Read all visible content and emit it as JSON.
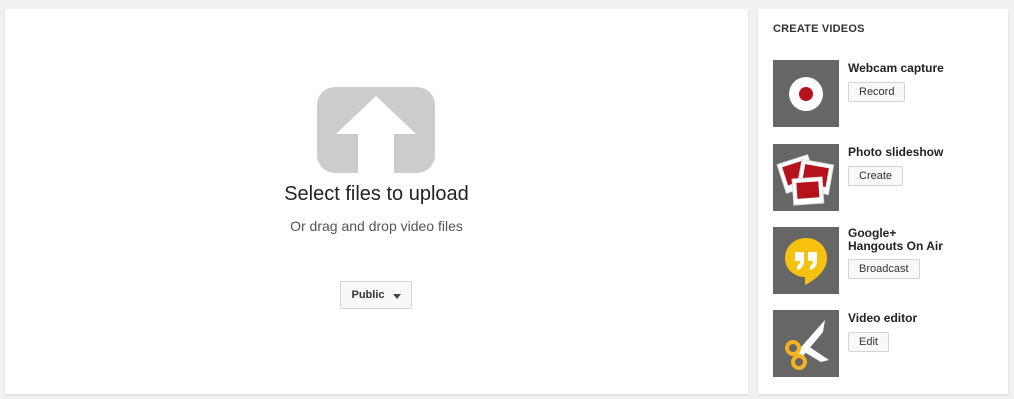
{
  "upload": {
    "title": "Select files to upload",
    "subtitle": "Or drag and drop video files",
    "privacy_label": "Public",
    "icon": "upload-arrow-icon"
  },
  "create": {
    "title": "CREATE VIDEOS",
    "items": [
      {
        "label": "Webcam capture",
        "button": "Record",
        "icon": "webcam-record-icon"
      },
      {
        "label": "Photo slideshow",
        "button": "Create",
        "icon": "photo-slideshow-icon"
      },
      {
        "label": "Google+\nHangouts On Air",
        "button": "Broadcast",
        "icon": "hangouts-icon"
      },
      {
        "label": "Video editor",
        "button": "Edit",
        "icon": "scissors-icon"
      }
    ]
  },
  "colors": {
    "thumb_bg": "#666666",
    "record_red": "#b5121b",
    "hangouts_yellow": "#f7c20f",
    "scissors_yellow": "#f4b223"
  }
}
